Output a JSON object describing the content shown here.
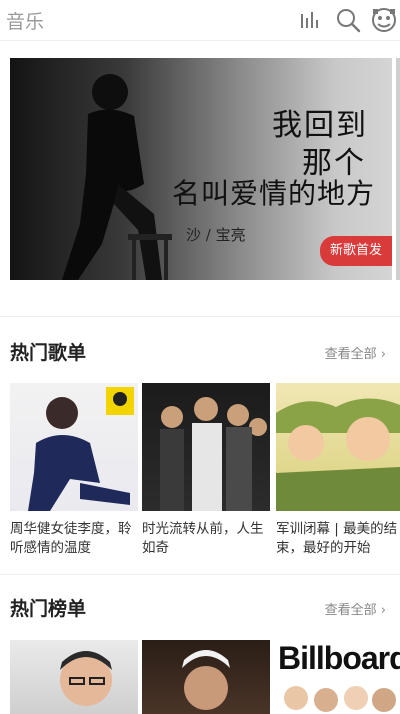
{
  "header": {
    "title": "音乐",
    "icons": [
      "bars-icon",
      "search-icon",
      "profile-icon"
    ]
  },
  "banner": {
    "line1": "我回到",
    "line2": "那个",
    "line3": "名叫爱情的地方",
    "artist": "沙 / 宝亮",
    "badge": "新歌首发"
  },
  "hot_playlists": {
    "title": "热门歌单",
    "more": "查看全部",
    "items": [
      {
        "caption": "周华健女徒李度，聆听感情的温度"
      },
      {
        "caption": "时光流转从前，人生如奇"
      },
      {
        "caption": "军训闭幕 | 最美的结束，最好的开始"
      }
    ]
  },
  "hot_charts": {
    "title": "热门榜单",
    "more": "查看全部",
    "items": [
      {
        "label": ""
      },
      {
        "label": ""
      },
      {
        "label": "Billboard"
      }
    ]
  },
  "colors": {
    "accent_red": "#d93a3a",
    "header_text": "#9a9a9a"
  }
}
